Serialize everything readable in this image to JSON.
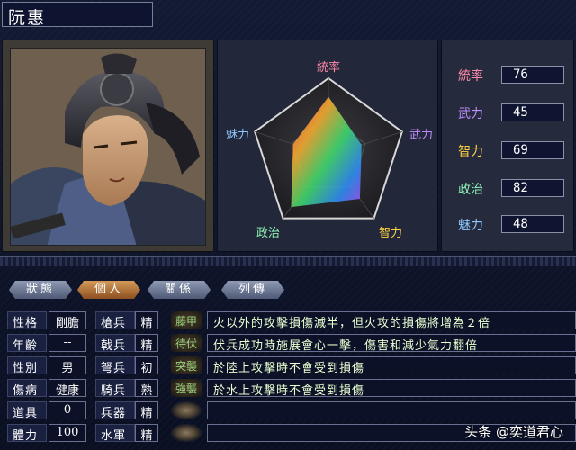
{
  "officer_name": "阮惠",
  "radar": {
    "labels": {
      "leadership": "統率",
      "war": "武力",
      "intelligence": "智力",
      "politics": "政治",
      "charm": "魅力"
    },
    "values": {
      "leadership": 76,
      "war": 45,
      "intelligence": 69,
      "politics": 82,
      "charm": 48
    },
    "max": 100
  },
  "stats": [
    {
      "label": "統率",
      "value": "76",
      "color": "#ff8aa8"
    },
    {
      "label": "武力",
      "value": "45",
      "color": "#c18cff"
    },
    {
      "label": "智力",
      "value": "69",
      "color": "#ffd447"
    },
    {
      "label": "政治",
      "value": "82",
      "color": "#8cf0b4"
    },
    {
      "label": "魅力",
      "value": "48",
      "color": "#8cc8ff"
    }
  ],
  "tabs": [
    "狀態",
    "個人",
    "關係",
    "列傳"
  ],
  "active_tab": "個人",
  "personal": [
    {
      "label": "性格",
      "value": "剛膽"
    },
    {
      "label": "年齡",
      "value": "--"
    },
    {
      "label": "性別",
      "value": "男"
    },
    {
      "label": "傷病",
      "value": "健康"
    },
    {
      "label": "道具",
      "value": "0"
    },
    {
      "label": "體力",
      "value": "100"
    }
  ],
  "troops": [
    {
      "label": "槍兵",
      "value": "精"
    },
    {
      "label": "戟兵",
      "value": "精"
    },
    {
      "label": "弩兵",
      "value": "初"
    },
    {
      "label": "騎兵",
      "value": "熟"
    },
    {
      "label": "兵器",
      "value": "精"
    },
    {
      "label": "水軍",
      "value": "精"
    }
  ],
  "skills": [
    {
      "name": "藤甲",
      "desc": "火以外的攻擊損傷減半，但火攻的損傷將增為２倍"
    },
    {
      "name": "待伏",
      "desc": "伏兵成功時施展會心一擊，傷害和減少氣力翻倍"
    },
    {
      "name": "突襲",
      "desc": "於陸上攻擊時不會受到損傷"
    },
    {
      "name": "強襲",
      "desc": "於水上攻擊時不會受到損傷"
    },
    {
      "name": "",
      "desc": ""
    },
    {
      "name": "",
      "desc": ""
    }
  ],
  "watermark": "头条 @奕道君心",
  "colors": {
    "panel": "#23273a",
    "active_tab": "#c0803c",
    "skill_text": "#e8ffd0"
  }
}
